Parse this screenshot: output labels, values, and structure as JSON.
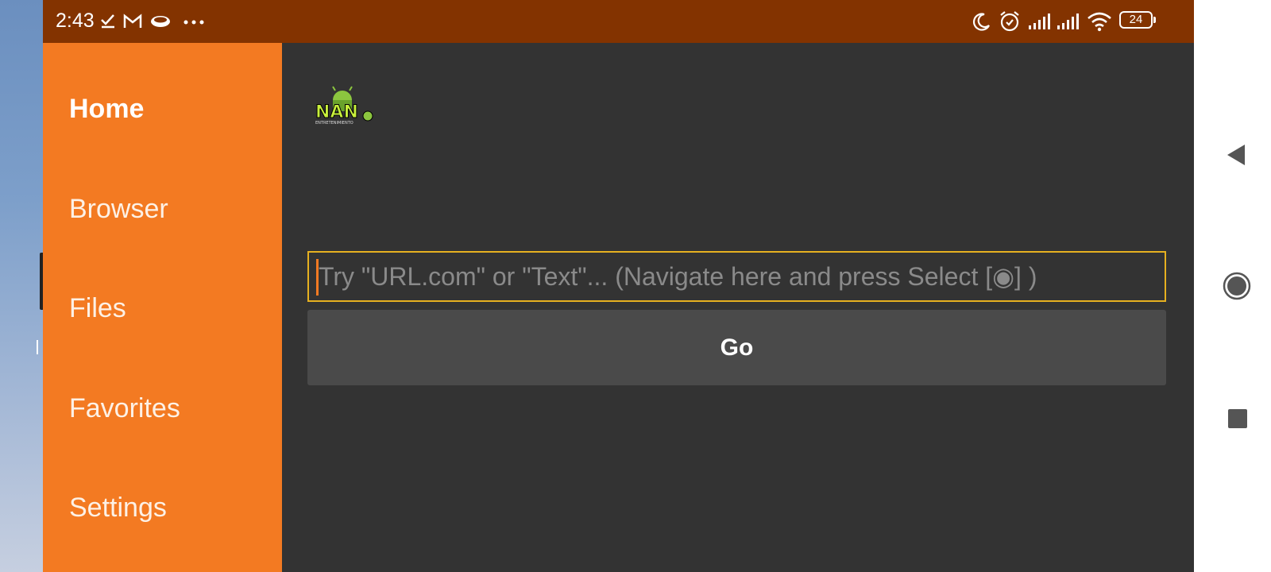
{
  "status_bar": {
    "time": "2:43",
    "battery_level": "24",
    "left_icons": [
      "checkmark-icon",
      "gmail-icon",
      "eye-icon",
      "more-dots-icon"
    ],
    "right_icons": [
      "moon-icon",
      "alarm-icon",
      "signal-icon",
      "signal-icon",
      "wifi-icon",
      "battery-icon"
    ],
    "color": "#833300"
  },
  "drawer": {
    "color": "#f37a22",
    "items": [
      {
        "label": "Home",
        "active": true
      },
      {
        "label": "Browser",
        "active": false
      },
      {
        "label": "Files",
        "active": false
      },
      {
        "label": "Favorites",
        "active": false
      },
      {
        "label": "Settings",
        "active": false
      }
    ]
  },
  "main": {
    "logo": {
      "text": "NAN",
      "subtext": "ENTRETENIMIENTO"
    },
    "search": {
      "value": "",
      "placeholder": "Try \"URL.com\" or \"Text\"... (Navigate here and press Select [◉] )"
    },
    "go_label": "Go"
  },
  "system_nav": {
    "buttons": [
      "back-icon",
      "home-circle-icon",
      "recents-square-icon"
    ]
  }
}
